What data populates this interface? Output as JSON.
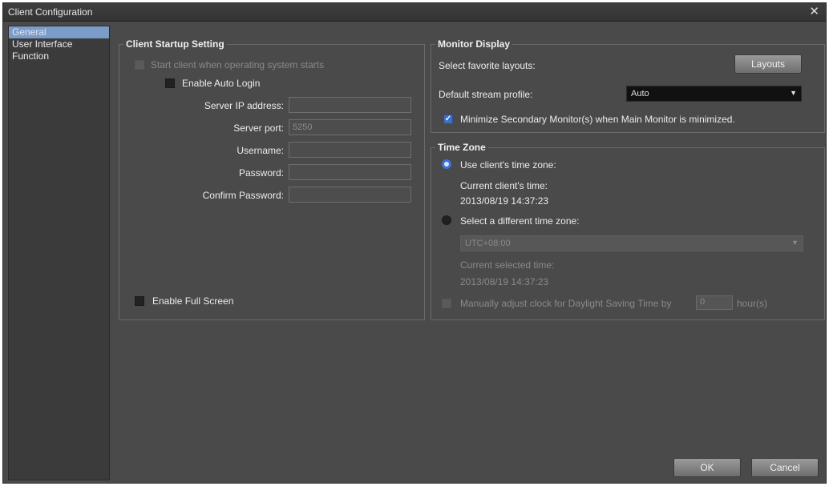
{
  "window": {
    "title": "Client Configuration",
    "close": "✕"
  },
  "sidebar": {
    "items": [
      {
        "label": "General",
        "selected": true
      },
      {
        "label": "User Interface",
        "selected": false
      },
      {
        "label": "Function",
        "selected": false
      }
    ]
  },
  "startup": {
    "legend": "Client Startup Setting",
    "start_with_os": "Start client when operating system starts",
    "auto_login": "Enable Auto Login",
    "server_ip_label": "Server IP address:",
    "server_ip_value": "",
    "server_port_label": "Server port:",
    "server_port_value": "5250",
    "username_label": "Username:",
    "username_value": "",
    "password_label": "Password:",
    "password_value": "",
    "confirm_label": "Confirm Password:",
    "confirm_value": "",
    "full_screen": "Enable Full Screen"
  },
  "monitor": {
    "legend": "Monitor Display",
    "favorite_label": "Select favorite layouts:",
    "layouts_button": "Layouts",
    "stream_label": "Default stream profile:",
    "stream_value": "Auto",
    "minimize_label": "Minimize Secondary Monitor(s) when Main Monitor is minimized.",
    "minimize_checked": true
  },
  "timezone": {
    "legend": "Time Zone",
    "use_client": "Use client's time zone:",
    "current_client_label": "Current client's time:",
    "current_client_value": "2013/08/19 14:37:23",
    "select_different": "Select a different time zone:",
    "tz_value": "UTC+08:00",
    "current_selected_label": "Current selected time:",
    "current_selected_value": "2013/08/19 14:37:23",
    "dst_prefix": "Manually adjust clock for Daylight Saving Time by",
    "dst_value": "0",
    "dst_suffix": "hour(s)"
  },
  "footer": {
    "ok": "OK",
    "cancel": "Cancel"
  },
  "colors": {
    "accent": "#3d72d6",
    "selected_nav": "#7b9bc9",
    "panel": "#4a4a4a"
  }
}
